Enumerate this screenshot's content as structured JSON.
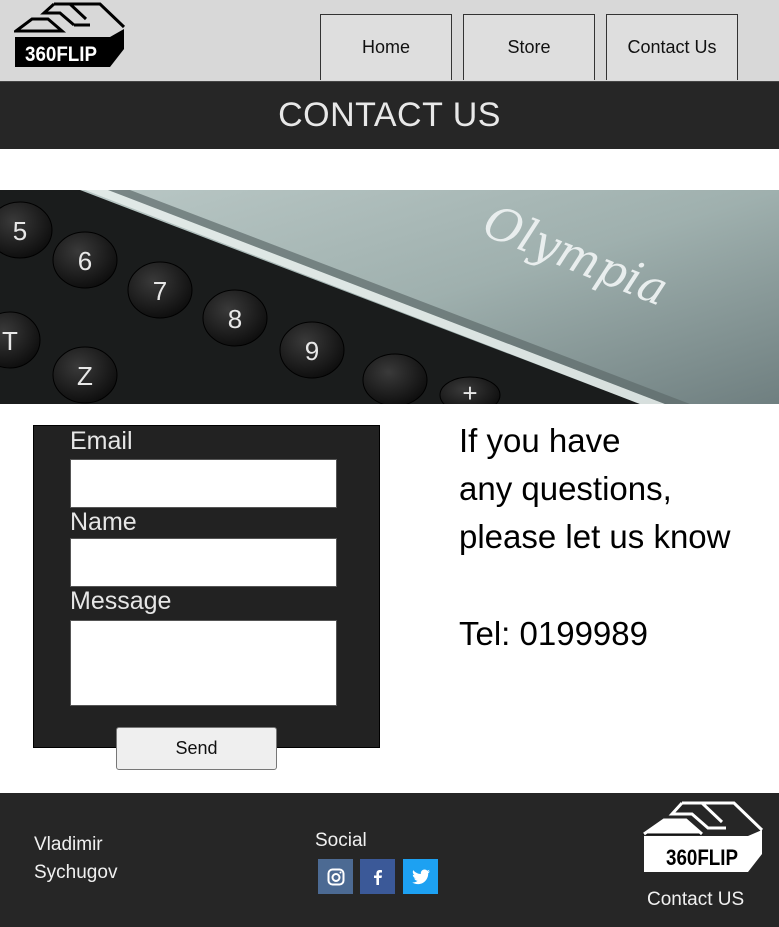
{
  "header": {
    "logo_text": "360FLIP",
    "nav": [
      "Home",
      "Store",
      "Contact Us"
    ]
  },
  "page_title": "CONTACT US",
  "banner": {
    "keys": [
      "5",
      "6",
      "7",
      "8",
      "9",
      "T",
      "Z",
      "+"
    ],
    "brand_script": "Olympia"
  },
  "form": {
    "email_label": "Email",
    "name_label": "Name",
    "message_label": "Message",
    "send_label": "Send"
  },
  "info": {
    "line1": "If you have",
    "line2": "any questions,",
    "line3": "please let us know",
    "tel": "Tel: 0199989"
  },
  "footer": {
    "name_line1": "Vladimir",
    "name_line2": "Sychugov",
    "social_label": "Social",
    "social_icons": [
      "instagram-icon",
      "facebook-icon",
      "twitter-icon"
    ],
    "logo_text": "360FLIP",
    "contact_link": "Contact US"
  },
  "colors": {
    "dark": "#262626",
    "header_bg": "#d8d8d8",
    "instagram": "#4c6a93",
    "facebook": "#3b5998",
    "twitter": "#1da1f2"
  }
}
